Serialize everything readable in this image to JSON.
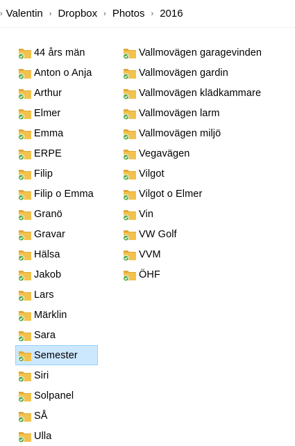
{
  "breadcrumb": {
    "lead_separator": "›",
    "segments": [
      "Valentin",
      "Dropbox",
      "Photos",
      "2016"
    ],
    "separator": "›"
  },
  "colors": {
    "folder": "#f3c24d",
    "folder_back": "#e2a737",
    "sync_badge": "#4ea944",
    "selection_bg": "#cce8ff",
    "selection_border": "#99d1ff"
  },
  "icons": {
    "folder": "folder-synced-icon",
    "separator": "chevron-right-icon"
  },
  "folders": {
    "column1": [
      "44 års män",
      "Anton o Anja",
      "Arthur",
      "Elmer",
      "Emma",
      "ERPE",
      "Filip",
      "Filip o Emma",
      "Granö",
      "Gravar",
      "Hälsa",
      "Jakob",
      "Lars",
      "Märklin",
      "Sara",
      "Semester",
      "Siri",
      "Solpanel",
      "SÅ",
      "Ulla"
    ],
    "column2": [
      "Vallmovägen garagevinden",
      "Vallmovägen gardin",
      "Vallmovägen klädkammare",
      "Vallmovägen larm",
      "Vallmovägen miljö",
      "Vegavägen",
      "Vilgot",
      "Vilgot o Elmer",
      "Vin",
      "VW Golf",
      "VVM",
      "ÖHF"
    ],
    "selected": "Semester"
  }
}
